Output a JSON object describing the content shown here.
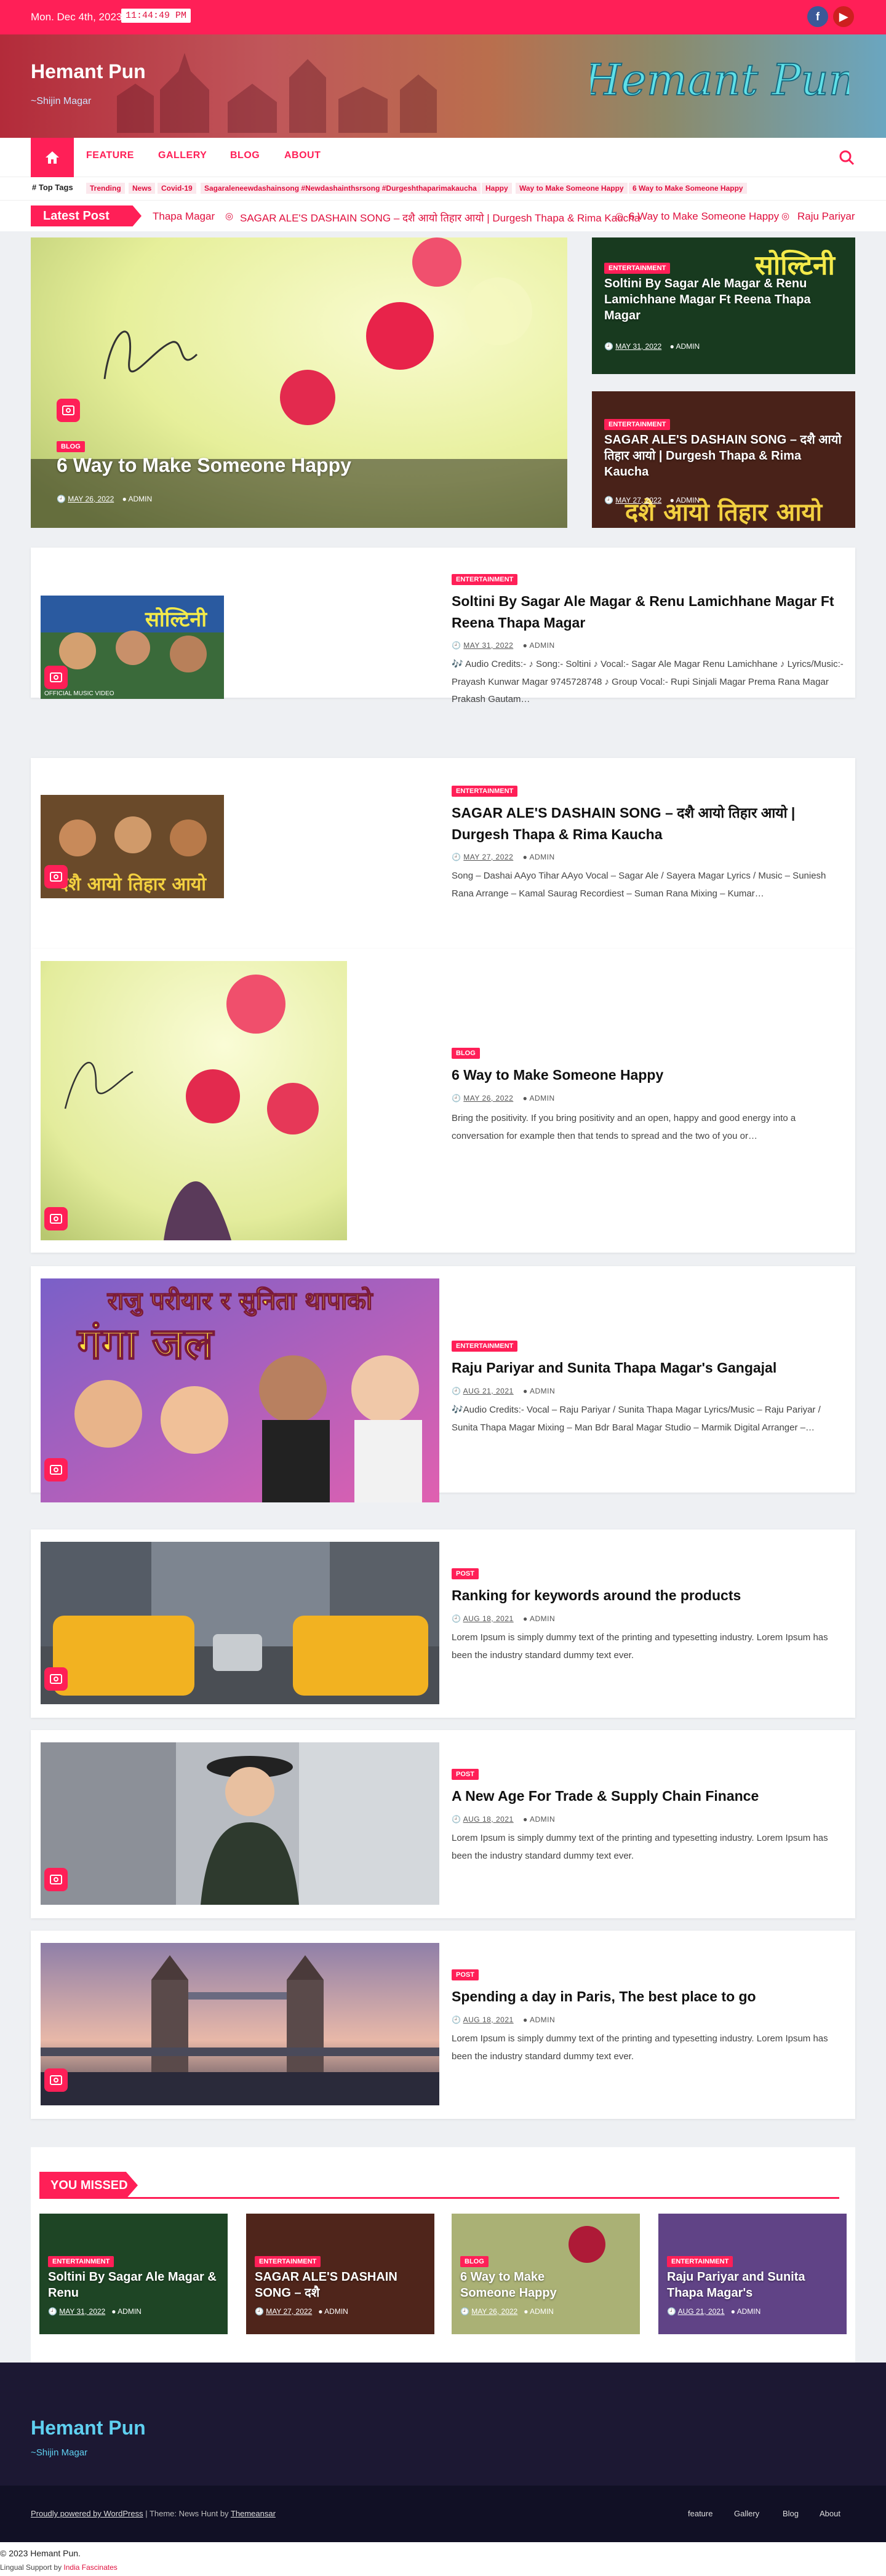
{
  "topbar": {
    "date": "Mon. Dec 4th, 2023",
    "time": "11:44:49 PM",
    "social": [
      {
        "icon": "facebook-icon",
        "glyph": "f",
        "color": "#3b5998"
      },
      {
        "icon": "youtube-icon",
        "glyph": "▶",
        "color": "#cd201f"
      }
    ]
  },
  "header": {
    "site_name": "Hemant Pun",
    "tagline": "~Shijin Magar",
    "logo_text": "Hemant Pun"
  },
  "nav": {
    "items": [
      "FEATURE",
      "GALLERY",
      "BLOG",
      "ABOUT"
    ]
  },
  "top_tags": {
    "label": "# Top Tags",
    "tags": [
      "Trending",
      "News",
      "Covid-19",
      "Sagaraleneewdashainsong #Newdashainthsrsong #Durgeshthaparimakaucha",
      "Happy",
      "Way to Make Someone Happy",
      "6 Way to Make Someone Happy"
    ]
  },
  "latest": {
    "label": "Latest Post",
    "items": [
      "Thapa Magar",
      "SAGAR ALE'S DASHAIN SONG – दशै आयो तिहार आयो | Durgesh Thapa & Rima Kaucha",
      "6 Way to Make Someone Happy",
      "Raju Pariyar"
    ]
  },
  "featured": {
    "main": {
      "category": "BLOG",
      "title": "6 Way to Make Someone Happy",
      "date": "MAY 26, 2022",
      "author": "ADMIN"
    },
    "side": [
      {
        "category": "ENTERTAINMENT",
        "title": "Soltini By Sagar Ale Magar & Renu Lamichhane Magar Ft Reena Thapa Magar",
        "date": "MAY 31, 2022",
        "author": "ADMIN",
        "image_text": "सोल्टिनी"
      },
      {
        "category": "ENTERTAINMENT",
        "title": "SAGAR ALE'S DASHAIN SONG – दशै आयो तिहार आयो | Durgesh Thapa & Rima Kaucha",
        "date": "MAY 27, 2022",
        "author": "ADMIN",
        "image_text": "दशै आयो तिहार आयो"
      }
    ]
  },
  "posts": [
    {
      "category": "ENTERTAINMENT",
      "title": "Soltini By Sagar Ale Magar & Renu Lamichhane Magar Ft Reena Thapa Magar",
      "date": "MAY 31, 2022",
      "author": "ADMIN",
      "excerpt": "🎶 Audio Credits:- ♪ Song:- Soltini ♪ Vocal:- Sagar Ale Magar Renu Lamichhane ♪ Lyrics/Music:- Prayash Kunwar Magar 9745728748 ♪ Group Vocal:- Rupi Sinjali Magar Prema Rana Magar Prakash Gautam…",
      "image_text": "सोल्टिनी",
      "image_caption": "OFFICIAL MUSIC VIDEO"
    },
    {
      "category": "ENTERTAINMENT",
      "title": "SAGAR ALE'S DASHAIN SONG – दशै आयो तिहार आयो | Durgesh Thapa & Rima Kaucha",
      "date": "MAY 27, 2022",
      "author": "ADMIN",
      "excerpt": "Song – Dashai AAyo Tihar AAyo Vocal – Sagar Ale / Sayera Magar Lyrics / Music – Suniesh Rana Arrange – Kamal Saurag Recordiest – Suman Rana Mixing – Kumar…",
      "image_text": "दशै आयो तिहार आयो"
    },
    {
      "category": "BLOG",
      "title": "6 Way to Make Someone Happy",
      "date": "MAY 26, 2022",
      "author": "ADMIN",
      "excerpt": "Bring the positivity. If you bring positivity and an open, happy and good energy into a conversation for example then that tends to spread and the two of you or…"
    },
    {
      "category": "ENTERTAINMENT",
      "title": "Raju Pariyar and Sunita Thapa Magar's Gangajal",
      "date": "AUG 21, 2021",
      "author": "ADMIN",
      "excerpt": "🎶Audio Credits:- Vocal – Raju Pariyar / Sunita Thapa Magar Lyrics/Music – Raju Pariyar / Sunita Thapa Magar Mixing – Man Bdr Baral Magar Studio – Marmik Digital Arranger –…",
      "image_text": "राजु परीयार र सुनिता थापाको",
      "image_text2": "गंगा जल"
    },
    {
      "category": "POST",
      "title": "Ranking for keywords around the products",
      "date": "AUG 18, 2021",
      "author": "ADMIN",
      "excerpt": "Lorem Ipsum is simply dummy text of the printing and typesetting industry. Lorem Ipsum has been the industry standard dummy text ever."
    },
    {
      "category": "POST",
      "title": "A New Age For Trade & Supply Chain Finance",
      "date": "AUG 18, 2021",
      "author": "ADMIN",
      "excerpt": "Lorem Ipsum is simply dummy text of the printing and typesetting industry. Lorem Ipsum has been the industry standard dummy text ever."
    },
    {
      "category": "POST",
      "title": "Spending a day in Paris, The best place to go",
      "date": "AUG 18, 2021",
      "author": "ADMIN",
      "excerpt": "Lorem Ipsum is simply dummy text of the printing and typesetting industry. Lorem Ipsum has been the industry standard dummy text ever."
    }
  ],
  "you_missed": {
    "label": "YOU MISSED",
    "items": [
      {
        "category": "ENTERTAINMENT",
        "title": "Soltini By Sagar Ale Magar & Renu",
        "date": "MAY 31, 2022",
        "author": "ADMIN"
      },
      {
        "category": "ENTERTAINMENT",
        "title": "SAGAR ALE'S DASHAIN SONG – दशै",
        "date": "MAY 27, 2022",
        "author": "ADMIN"
      },
      {
        "category": "BLOG",
        "title": "6 Way to Make Someone Happy",
        "date": "MAY 26, 2022",
        "author": "ADMIN"
      },
      {
        "category": "ENTERTAINMENT",
        "title": "Raju Pariyar and Sunita Thapa Magar's",
        "date": "AUG 21, 2021",
        "author": "ADMIN"
      }
    ]
  },
  "footer": {
    "site_name": "Hemant Pun",
    "tagline": "~Shijin Magar",
    "powered": "Proudly powered by WordPress",
    "theme_sep": " | Theme: News Hunt by ",
    "theme_author": "Themeansar",
    "links": [
      "feature",
      "Gallery",
      "Blog",
      "About"
    ],
    "copyright": "© 2023 Hemant Pun.",
    "lingual_prefix": "Lingual Support by ",
    "lingual_link": "India Fascinates"
  }
}
